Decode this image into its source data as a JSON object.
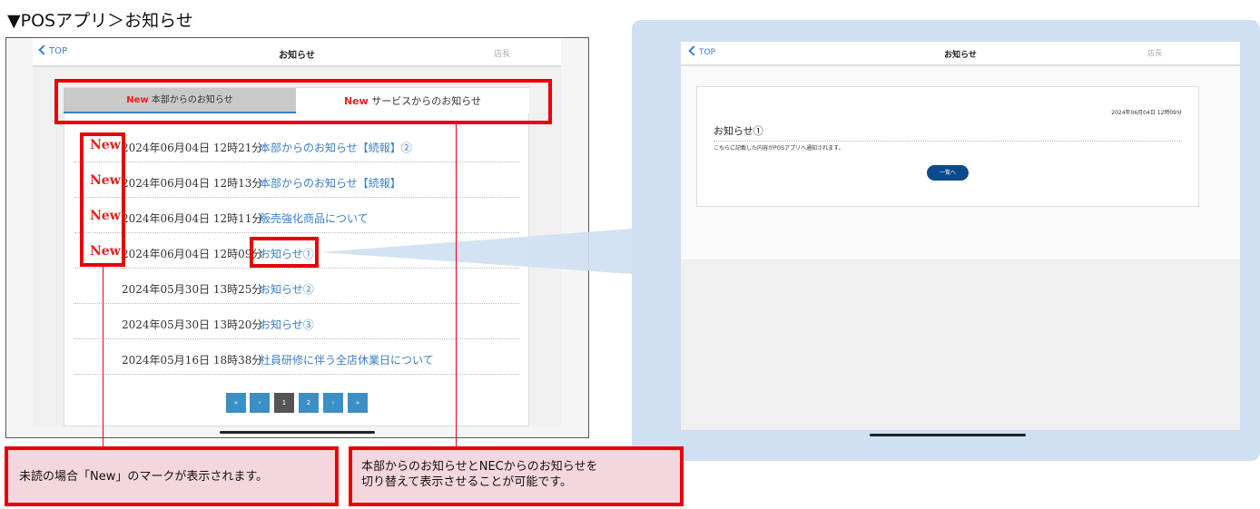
{
  "page_title": "▼POSアプリ＞お知らせ",
  "left": {
    "nav": {
      "back": "TOP",
      "title": "お知らせ",
      "role": "店長"
    },
    "tabs": {
      "hq_new": "New",
      "hq_label": "本部からのお知らせ",
      "svc_new": "New",
      "svc_label": "サービスからのお知らせ"
    },
    "rows": [
      {
        "new": "New",
        "date": "2024年06月04日 12時21分",
        "title": "本部からのお知らせ【続報】②"
      },
      {
        "new": "New",
        "date": "2024年06月04日 12時13分",
        "title": "本部からのお知らせ【続報】"
      },
      {
        "new": "New",
        "date": "2024年06月04日 12時11分",
        "title": "販売強化商品について"
      },
      {
        "new": "New",
        "date": "2024年06月04日 12時09分",
        "title": "お知らせ①"
      },
      {
        "new": "",
        "date": "2024年05月30日 13時25分",
        "title": "お知らせ②"
      },
      {
        "new": "",
        "date": "2024年05月30日 13時20分",
        "title": "お知らせ③"
      },
      {
        "new": "",
        "date": "2024年05月16日 18時38分",
        "title": "社員研修に伴う全店休業日について"
      }
    ],
    "pager": {
      "first": "«",
      "prev": "‹",
      "p1": "1",
      "p2": "2",
      "next": "›",
      "last": "»",
      "current": 1
    }
  },
  "right": {
    "nav": {
      "back": "TOP",
      "title": "お知らせ",
      "role": "店長"
    },
    "detail": {
      "date": "2024年06月04日 12時09分",
      "title": "お知らせ①",
      "body": "こちらに記載した内容がPOSアプリへ通知されます。",
      "button": "一覧へ"
    }
  },
  "callouts": {
    "new_mark": "未読の場合「New」のマークが表示されます。",
    "tabs_line1": "本部からのお知らせとNECからのお知らせを",
    "tabs_line2": "切り替えて表示させることが可能です。"
  },
  "colors": {
    "accent": "#3b7fc4",
    "new": "#e8201e",
    "highlight": "#e8000b",
    "callout_bg": "#f4d7de",
    "button": "#0b4a8b"
  }
}
